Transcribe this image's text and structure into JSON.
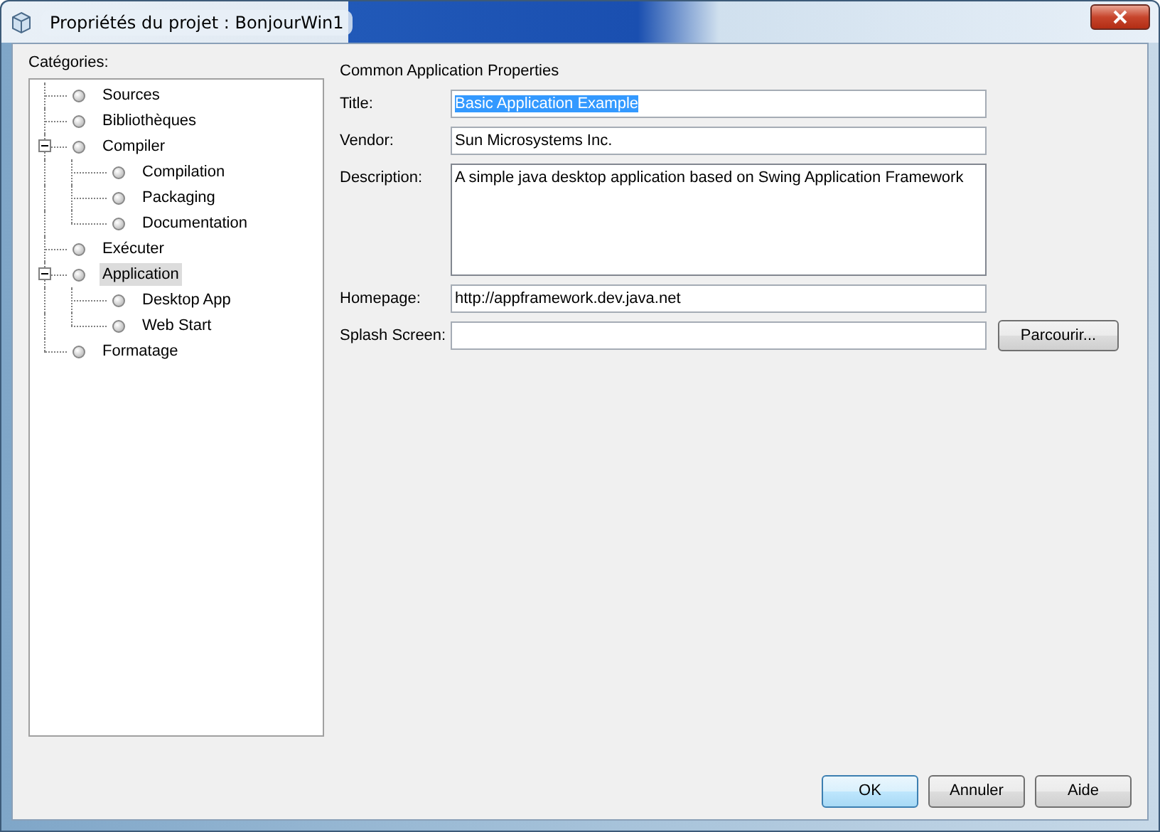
{
  "window": {
    "title": "Propriétés du projet : BonjourWin1"
  },
  "categories": {
    "label": "Catégories:",
    "items": [
      {
        "label": "Sources",
        "selected": false
      },
      {
        "label": "Bibliothèques",
        "selected": false
      },
      {
        "label": "Compiler",
        "selected": false,
        "expanded": true,
        "children": [
          {
            "label": "Compilation",
            "selected": false
          },
          {
            "label": "Packaging",
            "selected": false
          },
          {
            "label": "Documentation",
            "selected": false
          }
        ]
      },
      {
        "label": "Exécuter",
        "selected": false
      },
      {
        "label": "Application",
        "selected": true,
        "expanded": true,
        "children": [
          {
            "label": "Desktop App",
            "selected": false
          },
          {
            "label": "Web Start",
            "selected": false
          }
        ]
      },
      {
        "label": "Formatage",
        "selected": false
      }
    ]
  },
  "panel": {
    "heading": "Common Application Properties",
    "fields": [
      {
        "kind": "text",
        "label": "Title:",
        "value": "Basic Application Example",
        "text_selected": true
      },
      {
        "kind": "text",
        "label": "Vendor:",
        "value": "Sun Microsystems Inc.",
        "text_selected": false
      },
      {
        "kind": "textarea",
        "label": "Description:",
        "value": "A simple java desktop application based on Swing Application Framework",
        "text_selected": false
      },
      {
        "kind": "text",
        "label": "Homepage:",
        "value": "http://appframework.dev.java.net",
        "text_selected": false
      },
      {
        "kind": "browse",
        "label": "Splash Screen:",
        "button": "Parcourir..."
      }
    ]
  },
  "buttons": [
    {
      "label": "OK",
      "default": true
    },
    {
      "label": "Annuler",
      "default": false
    },
    {
      "label": "Aide",
      "default": false
    }
  ]
}
